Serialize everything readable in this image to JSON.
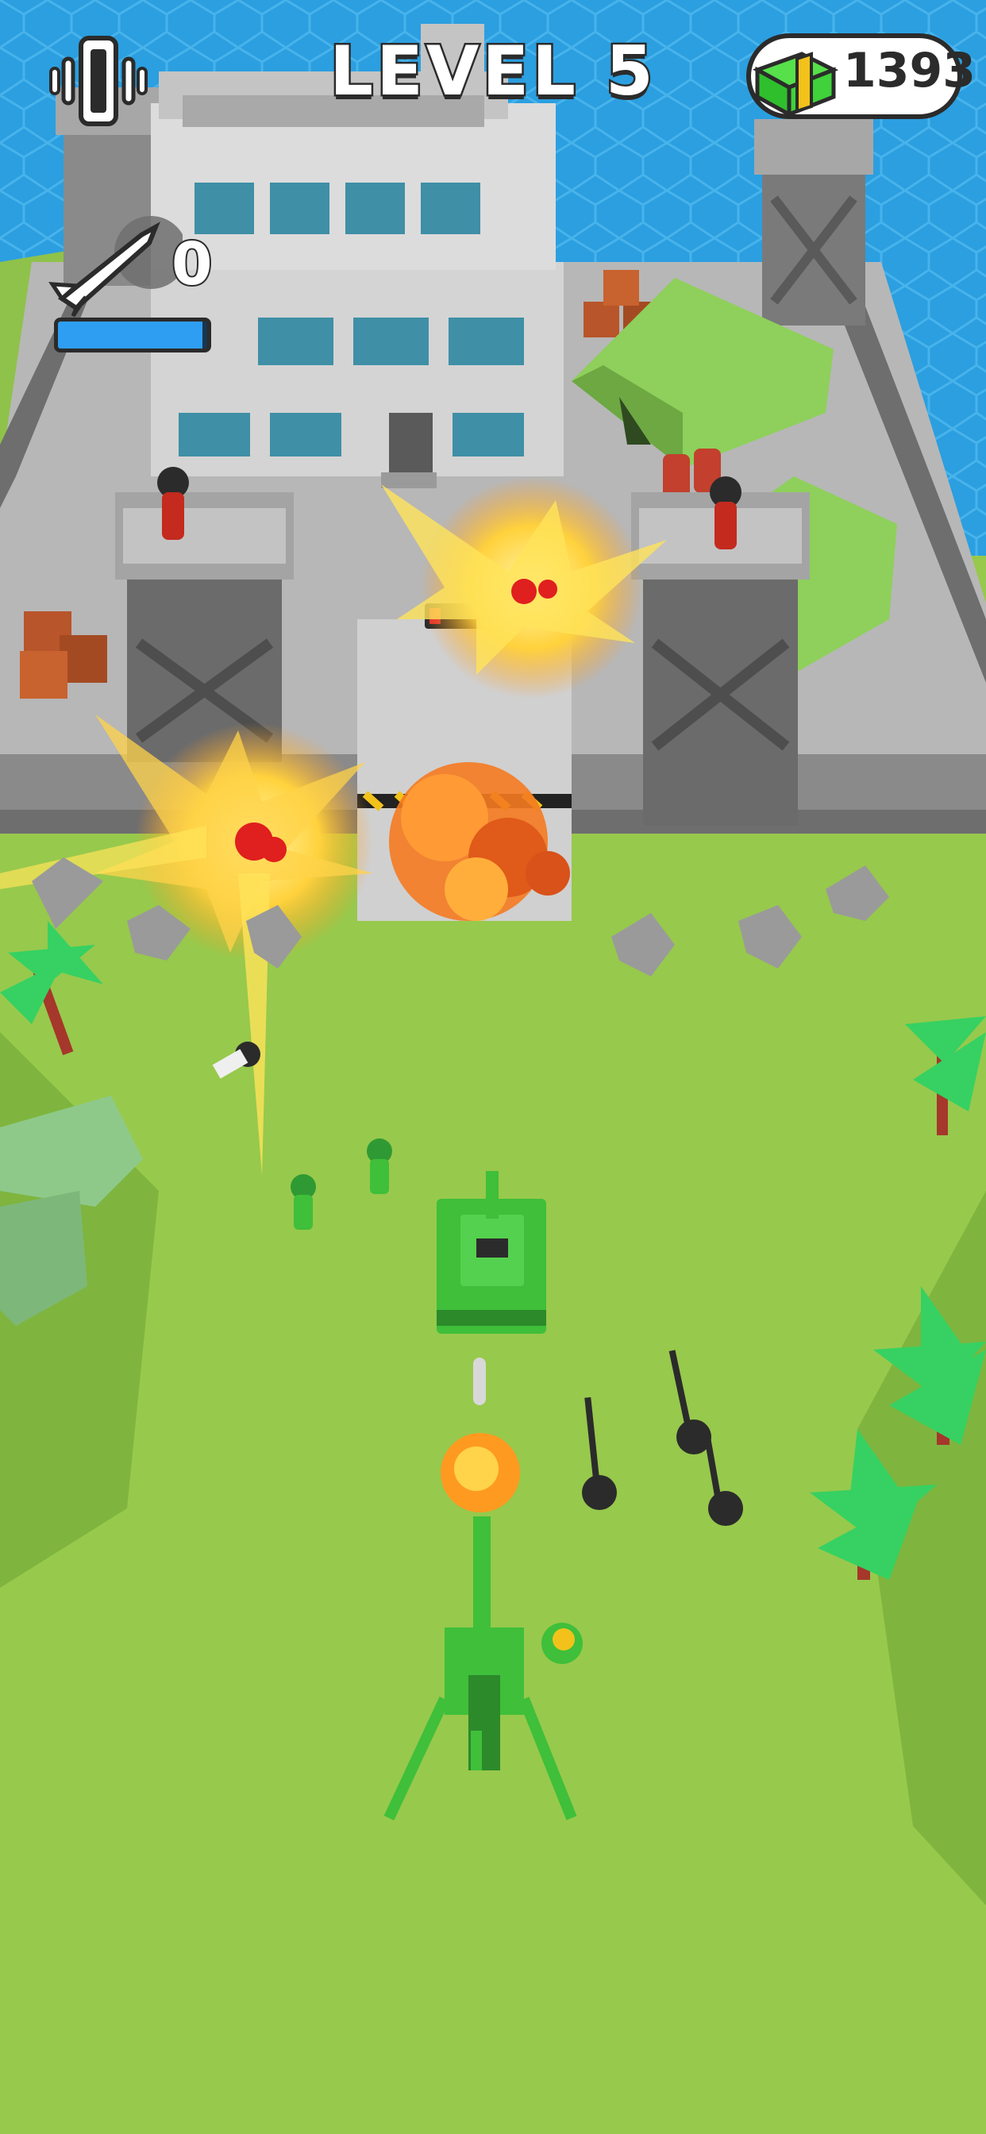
{
  "hud": {
    "level_label": "LEVEL 5",
    "cash": "1393",
    "missile_count": "0",
    "missile_charge_fraction": 0.97
  },
  "icons": {
    "vibrate": "vibrate-toggle-icon",
    "cash": "cash-stack-icon",
    "missile": "missile-icon"
  },
  "colors": {
    "player_army": "#3fbf3a",
    "enemy": "#c42a1e",
    "charge_bar": "#2e9ef2",
    "water": "#2b9fe0",
    "grass": "#97c94c"
  }
}
